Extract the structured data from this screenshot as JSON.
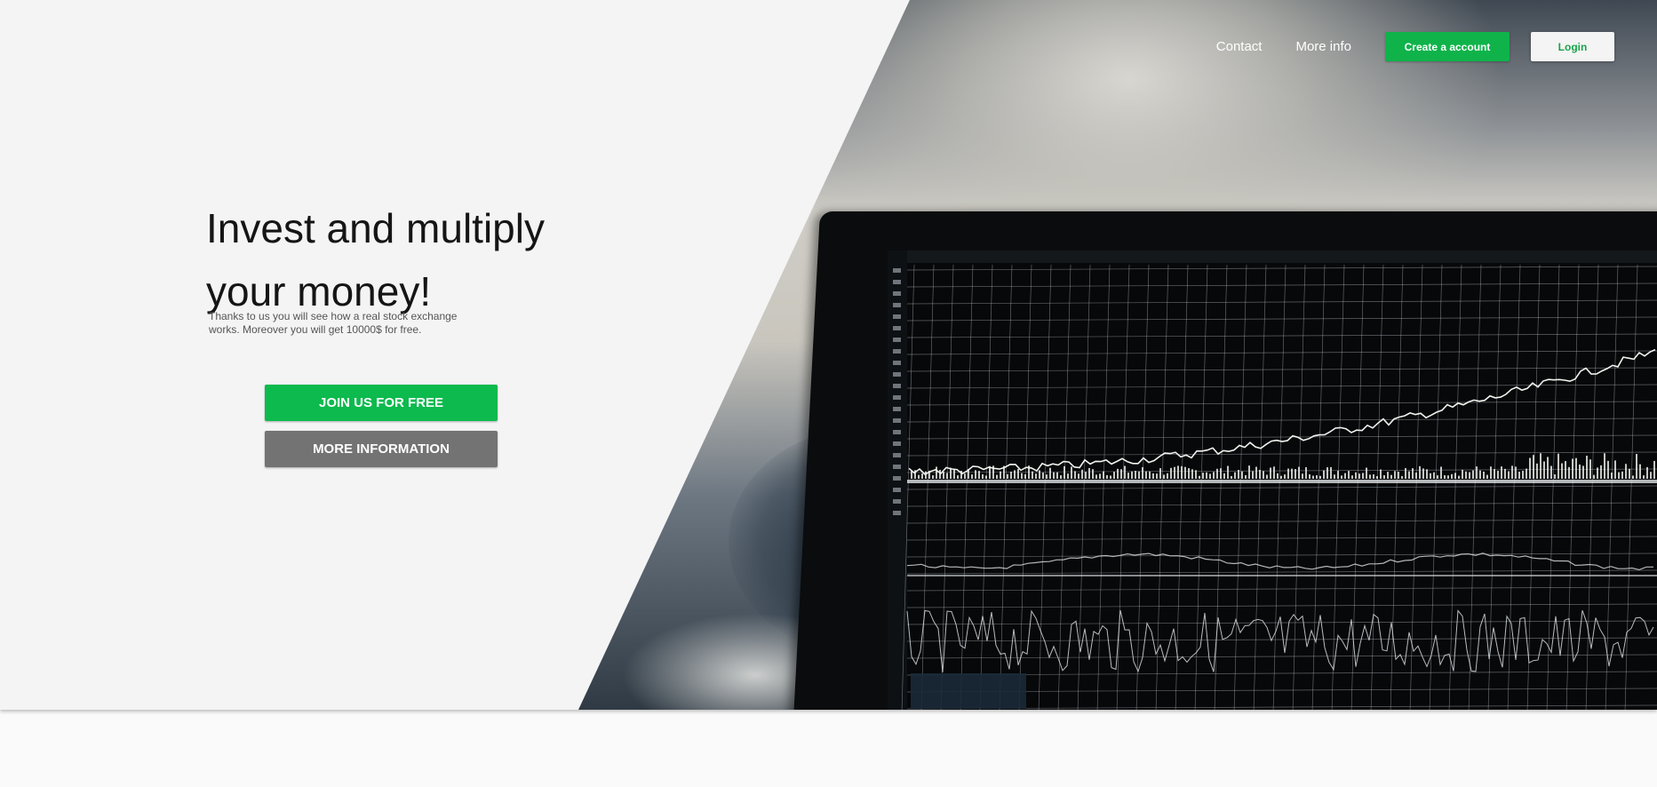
{
  "nav": {
    "contact_label": "Contact",
    "more_info_label": "More info",
    "create_account_label": "Create a account",
    "login_label": "Login"
  },
  "hero": {
    "headline": "Invest and multiply your money!",
    "description": "Thanks to us you will see how a real stock exchange works. Moreover you will get 10000$ for free.",
    "join_label": "JOIN US FOR FREE",
    "more_information_label": "MORE INFORMATION"
  },
  "colors": {
    "accent_green": "#0fb34a",
    "cta_gray": "#737373",
    "hero_background": "#f4f4f4",
    "page_background": "#fafafa"
  }
}
